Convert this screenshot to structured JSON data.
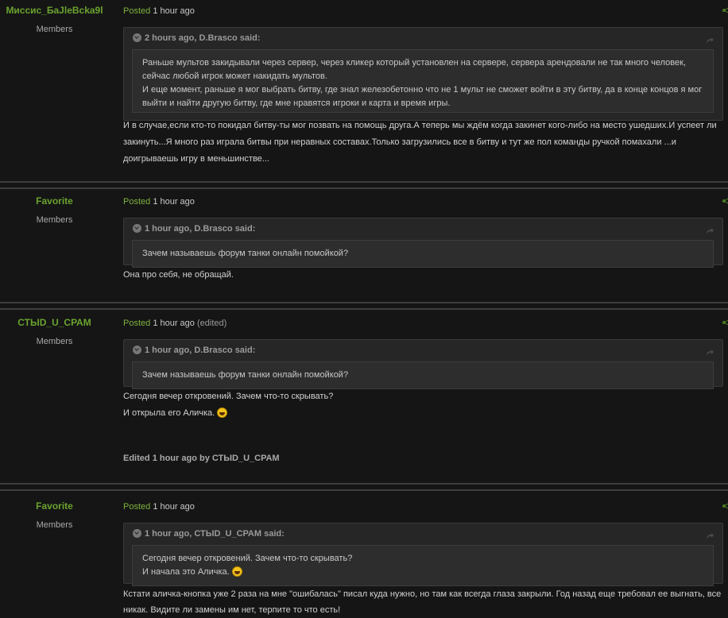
{
  "colors": {
    "accent": "#6aa32f",
    "background": "#151515"
  },
  "posts": [
    {
      "author": "Миссис_БаJleBcka9l",
      "group": "Members",
      "posted_label": "Posted",
      "time": "1 hour ago",
      "quote_header": "2 hours ago, D.Brasco said:",
      "quote_lines": [
        "Раньше мультов закидывали через сервер, через кликер который установлен на сервере, сервера арендовали не так много человек, сейчас любой игрок может накидать мультов.",
        "И еще момент, раньше я мог выбрать битву, где знал железобетонно что не 1 мульт не сможет войти в эту битву, да в конце концов я мог выйти и найти другую битву, где мне нравятся игроки и карта и время игры."
      ],
      "text_lines": [
        "И в случае,если кто-то покидал битву-ты мог позвать на помощь друга.А теперь мы ждём когда закинет кого-либо на место ушедших.И успеет ли закинуть...Я много раз играла битвы при неравных составах.Только загрузились все в битву и тут же пол команды ручкой помахали ...и доигрываешь игру в меньшинстве..."
      ]
    },
    {
      "author": "Favorite",
      "group": "Members",
      "posted_label": "Posted",
      "time": "1 hour ago",
      "quote_header": "1 hour ago, D.Brasco said:",
      "quote_lines": [
        "Зачем называешь форум танки онлайн помойкой?"
      ],
      "text_lines": [
        "Она про себя, не обращай."
      ]
    },
    {
      "author": "СТЫD_U_СРАМ",
      "group": "Members",
      "posted_label": "Posted",
      "time": "1 hour ago",
      "edited": "(edited)",
      "quote_header": "1 hour ago, D.Brasco said:",
      "quote_lines": [
        "Зачем называешь форум танки онлайн помойкой?"
      ],
      "text_lines": [
        "Сегодня вечер откровений. Зачем что-то скрывать?",
        "И открыла его Аличка."
      ],
      "edit_note": {
        "prefix": "Edited",
        "time": "1 hour ago",
        "by": "by",
        "user": "СТЫD_U_СРАМ"
      }
    },
    {
      "author": "Favorite",
      "group": "Members",
      "posted_label": "Posted",
      "time": "1 hour ago",
      "quote_header": "1 hour ago, СТЫD_U_СРАМ said:",
      "quote_lines": [
        "Сегодня вечер откровений. Зачем что-то скрывать?",
        "И начала это Аличка."
      ],
      "text_lines": [
        "Кстати аличка-кнопка уже 2 раза на мне \"ошибалась\" писал куда нужно, но там как всегда глаза закрыли. Год назад еще требовал ее выгнать, все никак. Видите ли замены им нет, терпите то что есть!"
      ]
    }
  ]
}
